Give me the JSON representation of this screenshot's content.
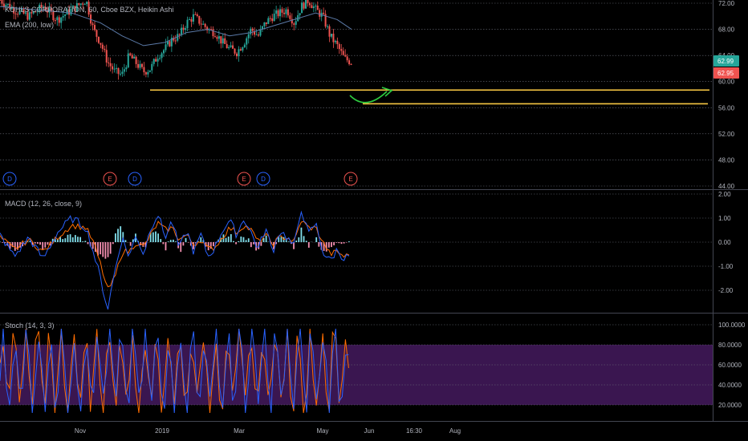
{
  "colors": {
    "background": "#000000",
    "candle_up": "#26a69a",
    "candle_down": "#ef5350",
    "ema": "#5b7aa8",
    "support": "#f5c542",
    "arrow": "#2ecc40",
    "macd_line": "#2962ff",
    "signal_line": "#ff6d00",
    "hist_up": "#80deea",
    "hist_down": "#f48fb1",
    "stoch_k": "#2962ff",
    "stoch_d": "#ff6d00",
    "stoch_band": "#3a1650",
    "price_badge_green": "#26a69a",
    "price_badge_red": "#ef5350",
    "dividend_event": "#2962ff",
    "earnings_event": "#ef5350"
  },
  "header": {
    "symbol_line": "KOHLS CORPORATION, 60, Cboe BZX, Heikin Ashi",
    "ema_label": "EMA (200, low)",
    "macd_label": "MACD (12, 26, close, 9)",
    "stoch_label": "Stoch (14, 3, 3)"
  },
  "price_badges": {
    "last": "62.99",
    "low": "62.95"
  },
  "x_axis_labels": [
    "Nov",
    "2019",
    "Mar",
    "May",
    "Jun",
    "16:30",
    "Aug"
  ],
  "events": [
    "D",
    "E",
    "D",
    "E",
    "D",
    "E"
  ],
  "chart_data": [
    {
      "type": "candlestick",
      "title": "KOHLS CORPORATION, 60, Cboe BZX, Heikin Ashi",
      "y_ticks": [
        "72.00",
        "68.00",
        "64.00",
        "60.00",
        "56.00",
        "52.00",
        "48.00",
        "44.00"
      ],
      "ylim": [
        44,
        72
      ],
      "close_path": [
        [
          0,
          72.5
        ],
        [
          4,
          71
        ],
        [
          8,
          70
        ],
        [
          12,
          71.5
        ],
        [
          16,
          69.5
        ],
        [
          20,
          71
        ],
        [
          24,
          72.5
        ],
        [
          26,
          68
        ],
        [
          28,
          66
        ],
        [
          30,
          63
        ],
        [
          32,
          61.5
        ],
        [
          34,
          61
        ],
        [
          36,
          64
        ],
        [
          38,
          62.8
        ],
        [
          40,
          61.5
        ],
        [
          42,
          62
        ],
        [
          44,
          64
        ],
        [
          46,
          65
        ],
        [
          48,
          66.5
        ],
        [
          50,
          67
        ],
        [
          52,
          69
        ],
        [
          54,
          70
        ],
        [
          56,
          69
        ],
        [
          58,
          68
        ],
        [
          60,
          67.5
        ],
        [
          62,
          66
        ],
        [
          64,
          65
        ],
        [
          66,
          64.5
        ],
        [
          68,
          66
        ],
        [
          70,
          68
        ],
        [
          72,
          67
        ],
        [
          74,
          69
        ],
        [
          76,
          70
        ],
        [
          78,
          70.5
        ],
        [
          80,
          71
        ],
        [
          82,
          69
        ],
        [
          84,
          71.5
        ],
        [
          86,
          72.5
        ],
        [
          88,
          71
        ],
        [
          90,
          70
        ],
        [
          92,
          67
        ],
        [
          94,
          65.5
        ],
        [
          96,
          63.5
        ],
        [
          98,
          63
        ]
      ],
      "ema_path": [
        [
          0,
          71.5
        ],
        [
          10,
          71
        ],
        [
          20,
          70.5
        ],
        [
          28,
          69
        ],
        [
          34,
          67
        ],
        [
          40,
          65.5
        ],
        [
          46,
          66
        ],
        [
          52,
          67.5
        ],
        [
          58,
          68
        ],
        [
          64,
          67
        ],
        [
          70,
          67.5
        ],
        [
          76,
          68.5
        ],
        [
          82,
          69.5
        ],
        [
          88,
          70.5
        ],
        [
          94,
          69.5
        ],
        [
          98,
          68
        ]
      ],
      "support_levels": [
        58.7,
        56.6
      ],
      "last_price": 62.99,
      "low_price": 62.95
    },
    {
      "type": "line",
      "title": "MACD (12, 26, close, 9)",
      "y_ticks": [
        "2.00",
        "1.00",
        "0.00",
        "-1.00",
        "-2.00"
      ],
      "ylim": [
        -3,
        2
      ],
      "macd_path": [
        [
          0,
          0.3
        ],
        [
          4,
          -0.6
        ],
        [
          8,
          0.2
        ],
        [
          12,
          -0.7
        ],
        [
          16,
          0.4
        ],
        [
          20,
          1.0
        ],
        [
          24,
          0.6
        ],
        [
          26,
          -0.4
        ],
        [
          28,
          -1.5
        ],
        [
          30,
          -2.8
        ],
        [
          32,
          -1.2
        ],
        [
          34,
          0.2
        ],
        [
          36,
          -0.6
        ],
        [
          38,
          0.3
        ],
        [
          40,
          -0.5
        ],
        [
          42,
          0.6
        ],
        [
          44,
          1.2
        ],
        [
          46,
          0.2
        ],
        [
          48,
          0.9
        ],
        [
          50,
          -0.3
        ],
        [
          52,
          0.5
        ],
        [
          54,
          -0.4
        ],
        [
          56,
          0.3
        ],
        [
          58,
          -0.6
        ],
        [
          60,
          -0.2
        ],
        [
          62,
          0.5
        ],
        [
          64,
          0.9
        ],
        [
          66,
          0.3
        ],
        [
          68,
          1.0
        ],
        [
          70,
          0.4
        ],
        [
          72,
          -0.3
        ],
        [
          74,
          0.6
        ],
        [
          76,
          -0.4
        ],
        [
          78,
          0.5
        ],
        [
          80,
          0.2
        ],
        [
          82,
          -0.2
        ],
        [
          84,
          1.4
        ],
        [
          86,
          0.3
        ],
        [
          88,
          0.8
        ],
        [
          90,
          -0.4
        ],
        [
          92,
          -0.8
        ],
        [
          94,
          -0.3
        ],
        [
          96,
          -0.7
        ],
        [
          98,
          -0.5
        ]
      ],
      "signal_path": [
        [
          0,
          0.2
        ],
        [
          4,
          -0.3
        ],
        [
          8,
          0.1
        ],
        [
          12,
          -0.4
        ],
        [
          16,
          0.2
        ],
        [
          20,
          0.7
        ],
        [
          24,
          0.6
        ],
        [
          26,
          0.0
        ],
        [
          28,
          -0.9
        ],
        [
          30,
          -2.0
        ],
        [
          32,
          -1.5
        ],
        [
          34,
          -0.4
        ],
        [
          36,
          -0.4
        ],
        [
          38,
          0.0
        ],
        [
          40,
          -0.2
        ],
        [
          42,
          0.3
        ],
        [
          44,
          0.8
        ],
        [
          46,
          0.5
        ],
        [
          48,
          0.6
        ],
        [
          50,
          0.1
        ],
        [
          52,
          0.3
        ],
        [
          54,
          -0.1
        ],
        [
          56,
          0.1
        ],
        [
          58,
          -0.3
        ],
        [
          60,
          -0.2
        ],
        [
          62,
          0.2
        ],
        [
          64,
          0.6
        ],
        [
          66,
          0.4
        ],
        [
          68,
          0.7
        ],
        [
          70,
          0.5
        ],
        [
          72,
          0.0
        ],
        [
          74,
          0.3
        ],
        [
          76,
          -0.1
        ],
        [
          78,
          0.2
        ],
        [
          80,
          0.2
        ],
        [
          82,
          0.0
        ],
        [
          84,
          0.9
        ],
        [
          86,
          0.6
        ],
        [
          88,
          0.6
        ],
        [
          90,
          0.0
        ],
        [
          92,
          -0.5
        ],
        [
          94,
          -0.4
        ],
        [
          96,
          -0.6
        ],
        [
          98,
          -0.5
        ]
      ],
      "hist_path": [
        [
          0,
          0.1
        ],
        [
          4,
          -0.3
        ],
        [
          8,
          0.1
        ],
        [
          12,
          -0.3
        ],
        [
          16,
          0.2
        ],
        [
          20,
          0.3
        ],
        [
          24,
          0.0
        ],
        [
          26,
          -0.4
        ],
        [
          28,
          -0.6
        ],
        [
          30,
          -0.8
        ],
        [
          32,
          0.3
        ],
        [
          34,
          0.6
        ],
        [
          36,
          -0.2
        ],
        [
          38,
          0.3
        ],
        [
          40,
          -0.3
        ],
        [
          42,
          0.3
        ],
        [
          44,
          0.4
        ],
        [
          46,
          -0.3
        ],
        [
          48,
          0.3
        ],
        [
          50,
          -0.4
        ],
        [
          52,
          0.2
        ],
        [
          54,
          -0.3
        ],
        [
          56,
          0.2
        ],
        [
          58,
          -0.3
        ],
        [
          60,
          0.0
        ],
        [
          62,
          0.3
        ],
        [
          64,
          0.3
        ],
        [
          66,
          -0.1
        ],
        [
          68,
          0.3
        ],
        [
          70,
          -0.1
        ],
        [
          72,
          -0.3
        ],
        [
          74,
          0.3
        ],
        [
          76,
          -0.3
        ],
        [
          78,
          0.3
        ],
        [
          80,
          0.0
        ],
        [
          82,
          -0.2
        ],
        [
          84,
          0.5
        ],
        [
          86,
          -0.3
        ],
        [
          88,
          0.2
        ],
        [
          90,
          -0.4
        ],
        [
          92,
          -0.3
        ],
        [
          94,
          0.1
        ],
        [
          96,
          -0.1
        ],
        [
          98,
          0.0
        ]
      ]
    },
    {
      "type": "line",
      "title": "Stoch (14, 3, 3)",
      "y_ticks": [
        "100.0000",
        "80.0000",
        "60.0000",
        "40.0000",
        "20.0000"
      ],
      "ylim": [
        10,
        110
      ],
      "band": [
        20,
        80
      ]
    }
  ]
}
